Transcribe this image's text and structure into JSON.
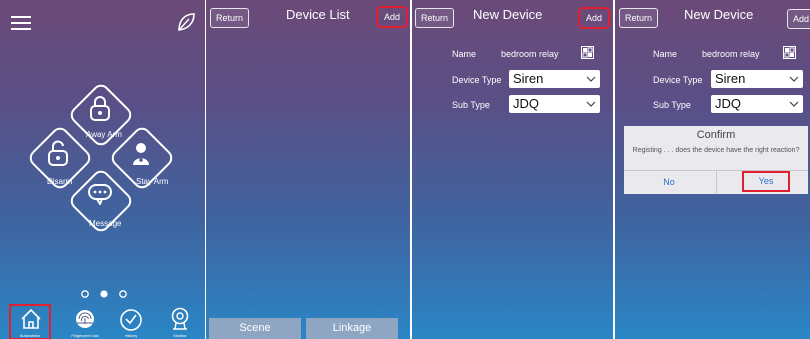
{
  "panel1": {
    "modes": {
      "away_arm": "Away Arm",
      "disarm": "Disarm",
      "stay_arm": "Stay Arm",
      "message": "Message"
    },
    "tabs": {
      "automation": "Automation",
      "fingerprint_lock": "Fingerprint lock",
      "history": "History",
      "monitor": "Monitor"
    }
  },
  "panel2": {
    "return": "Return",
    "title": "Device  List",
    "add": "Add",
    "scene": "Scene",
    "linkage": "Linkage"
  },
  "panel3": {
    "return": "Return",
    "title": "New  Device",
    "add": "Add",
    "name_label": "Name",
    "name_value": "bedroom relay",
    "device_type_label": "Device Type",
    "device_type_value": "Siren",
    "sub_type_label": "Sub Type",
    "sub_type_value": "JDQ"
  },
  "panel4": {
    "return": "Return",
    "title": "New  Device",
    "add": "Add",
    "name_label": "Name",
    "name_value": "bedroom relay",
    "device_type_label": "Device Type",
    "device_type_value": "Siren",
    "sub_type_label": "Sub Type",
    "sub_type_value": "JDQ",
    "dialog": {
      "title": "Confirm",
      "message": "Registing . . . does the device have the right reaction?",
      "no": "No",
      "yes": "Yes"
    }
  },
  "colors": {
    "highlight": "#e02030",
    "dialog_button": "#2f6fc9"
  }
}
